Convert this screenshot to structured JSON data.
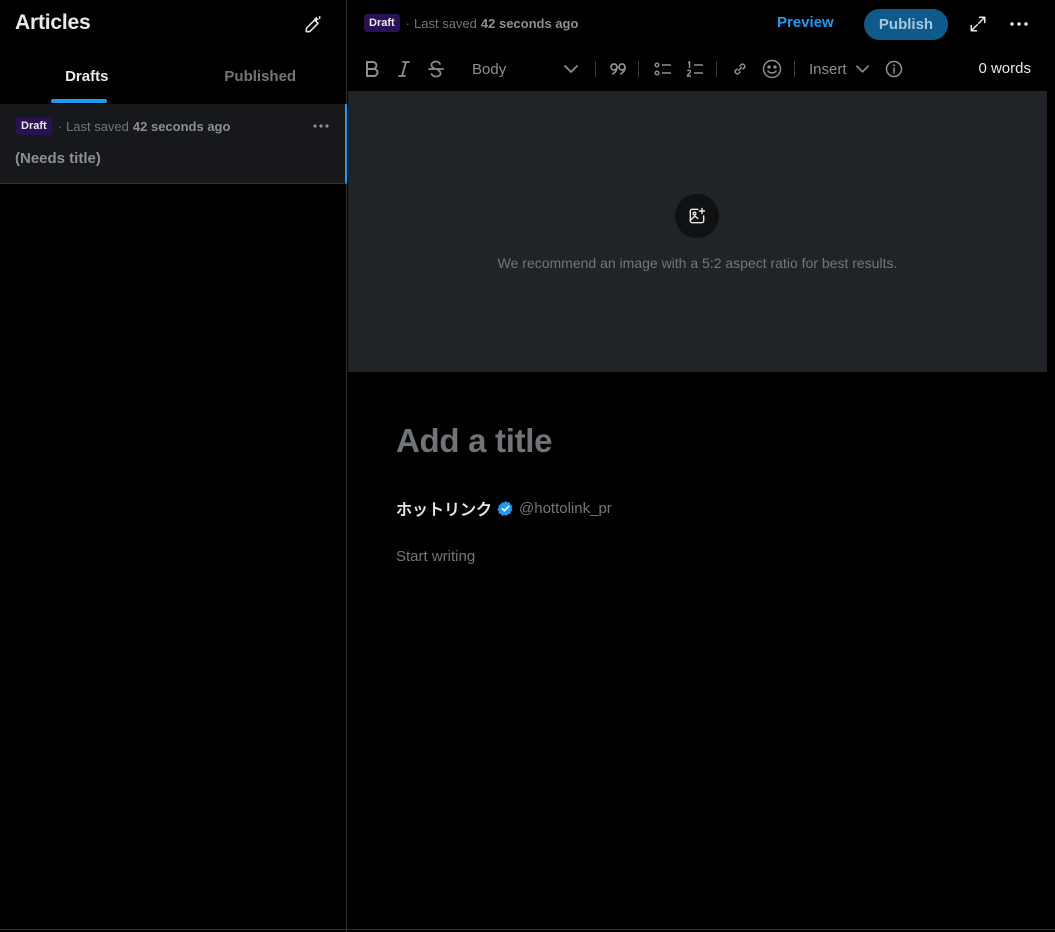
{
  "sidebar": {
    "title": "Articles",
    "compose_icon": "compose-article-icon",
    "tabs": [
      {
        "label": "Drafts",
        "active": true
      },
      {
        "label": "Published",
        "active": false
      }
    ],
    "drafts": [
      {
        "badge": "Draft",
        "separator": "·",
        "saved_prefix": "Last saved",
        "saved_time": "42 seconds ago",
        "title": "(Needs title)"
      }
    ]
  },
  "topbar": {
    "badge": "Draft",
    "separator": "·",
    "saved_prefix": "Last saved",
    "saved_time": "42 seconds ago",
    "preview_label": "Preview",
    "publish_label": "Publish"
  },
  "toolbar": {
    "text_style": "Body",
    "insert_label": "Insert",
    "word_count": "0 words",
    "icons": [
      "bold-icon",
      "italic-icon",
      "strikethrough-icon",
      "quote-icon",
      "bulleted-list-icon",
      "numbered-list-icon",
      "link-icon",
      "emoji-icon",
      "info-icon"
    ]
  },
  "cover": {
    "hint": "We recommend an image with a 5:2 aspect ratio for best results."
  },
  "editor": {
    "title_placeholder": "Add a title",
    "author_name": "ホットリンク",
    "author_handle": "@hottolink_pr",
    "body_placeholder": "Start writing"
  },
  "colors": {
    "accent": "#1d9bf0",
    "badge_bg": "#2a1054",
    "publish_bg": "#0e5a8a",
    "cover_bg": "#202327"
  }
}
